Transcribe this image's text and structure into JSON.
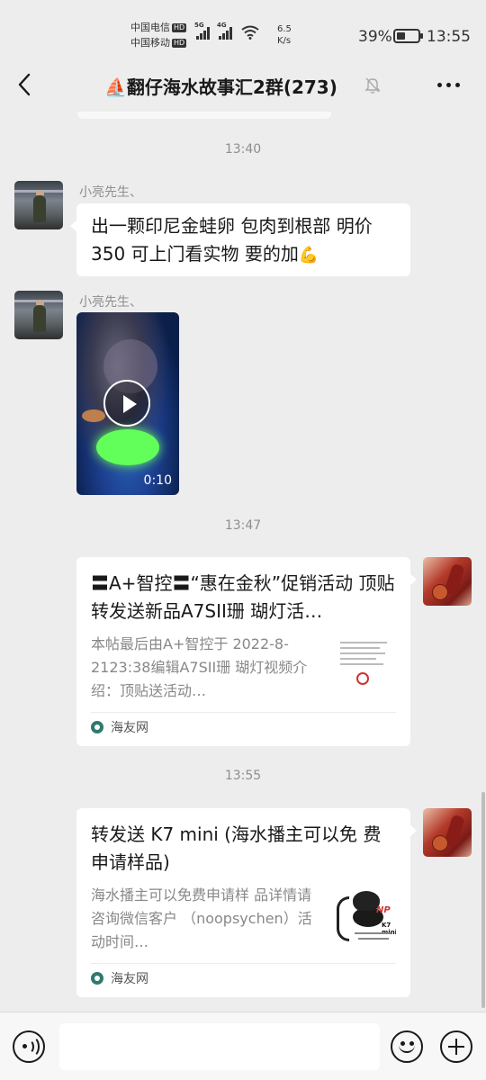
{
  "status_bar": {
    "carrier1": "中国电信",
    "carrier2": "中国移动",
    "hd": "HD",
    "net_speed_value": "6.5",
    "net_speed_unit": "K/s",
    "signal_label_5g": "5G",
    "signal_label_4g": "4G",
    "battery_percent": "39%",
    "battery_level": 0.39,
    "time": "13:55"
  },
  "nav": {
    "title": "⛵翻仔海水故事汇2群(273)",
    "back_icon": "chevron-left-icon",
    "mute_icon": "bell-off-icon",
    "more_icon": "more-dots-icon"
  },
  "messages": {
    "ts1": "13:40",
    "msg1": {
      "sender": "小亮先生、",
      "text": "出一颗印尼金蛙卵 包肉到根部 明价 350 可上门看实物 要的加",
      "emoji": "💪"
    },
    "msg2": {
      "sender": "小亮先生、",
      "duration": "0:10"
    },
    "ts2": "13:47",
    "msg3": {
      "title": "〓A+智控〓“惠在金秋”促销活动 顶贴转发送新品A7SII珊 瑚灯活…",
      "desc": "本帖最后由A+智控于 2022-8-2123:38编辑A7SII珊 瑚灯视频介绍：顶贴送活动…",
      "source": "海友网"
    },
    "ts3": "13:55",
    "msg4": {
      "title": "转发送 K7 mini (海水播主可以免 费申请样品)",
      "desc": "海水播主可以免费申请样 品详情请咨询微信客户 （noopsychen）活动时间…",
      "source": "海友网",
      "thumb_brand": "NP",
      "thumb_model": "K7 mini"
    }
  },
  "input_bar": {
    "placeholder": ""
  },
  "colors": {
    "background": "#ededed",
    "bubble": "#ffffff",
    "timestamp": "#8e8e8e",
    "source_icon": "#2f7a6e"
  }
}
